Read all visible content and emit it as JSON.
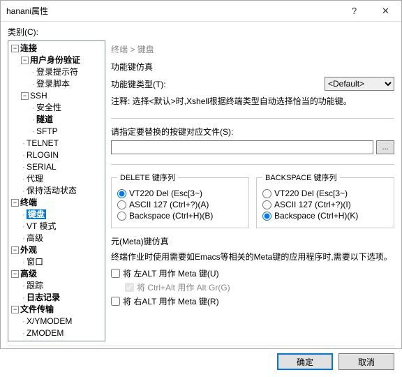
{
  "titlebar": {
    "title": "hanani属性"
  },
  "category_label": "类别(C):",
  "tree": {
    "connection": "连接",
    "user_auth": "用户身份验证",
    "login_prompt": "登录提示符",
    "login_script": "登录脚本",
    "ssh": "SSH",
    "security": "安全性",
    "tunnel": "隧道",
    "sftp": "SFTP",
    "telnet": "TELNET",
    "rlogin": "RLOGIN",
    "serial": "SERIAL",
    "proxy": "代理",
    "keep_alive": "保持活动状态",
    "terminal": "终端",
    "keyboard": "键盘",
    "vt_mode": "VT 模式",
    "advanced_term": "高级",
    "appearance": "外观",
    "window": "窗口",
    "advanced": "高级",
    "trace": "跟踪",
    "log": "日志记录",
    "file_transfer": "文件传输",
    "xymodem": "X/YMODEM",
    "zmodem": "ZMODEM"
  },
  "breadcrumb": {
    "terminal": "终端",
    "sep": ">",
    "keyboard": "键盘"
  },
  "funckey": {
    "section": "功能键仿真",
    "type_label": "功能键类型(T):",
    "type_value": "<Default>",
    "note": "注释: 选择<默认>时,Xshell根据终端类型自动选择恰当的功能键。"
  },
  "mapfile": {
    "label": "请指定要替换的按键对应文件(S):",
    "browse": "..."
  },
  "delete": {
    "legend": "DELETE 键序列",
    "opt1": "VT220 Del (Esc[3~)",
    "opt2": "ASCII 127 (Ctrl+?)(A)",
    "opt3": "Backspace (Ctrl+H)(B)"
  },
  "backspace": {
    "legend": "BACKSPACE 键序列",
    "opt1": "VT220 Del (Esc[3~)",
    "opt2": "ASCII 127 (Ctrl+?)(I)",
    "opt3": "Backspace (Ctrl+H)(K)"
  },
  "meta": {
    "title": "元(Meta)键仿真",
    "desc": "终端作业时使用需要如Emacs等相关的Meta键的应用程序时,需要以下选项。",
    "left_alt": "将 左ALT 用作 Meta 键(U)",
    "ctrl_alt": "将 Ctrl+Alt 用作 Alt Gr(G)",
    "right_alt": "将 右ALT 用作 Meta 键(R)"
  },
  "footer": {
    "ok": "确定",
    "cancel": "取消"
  }
}
